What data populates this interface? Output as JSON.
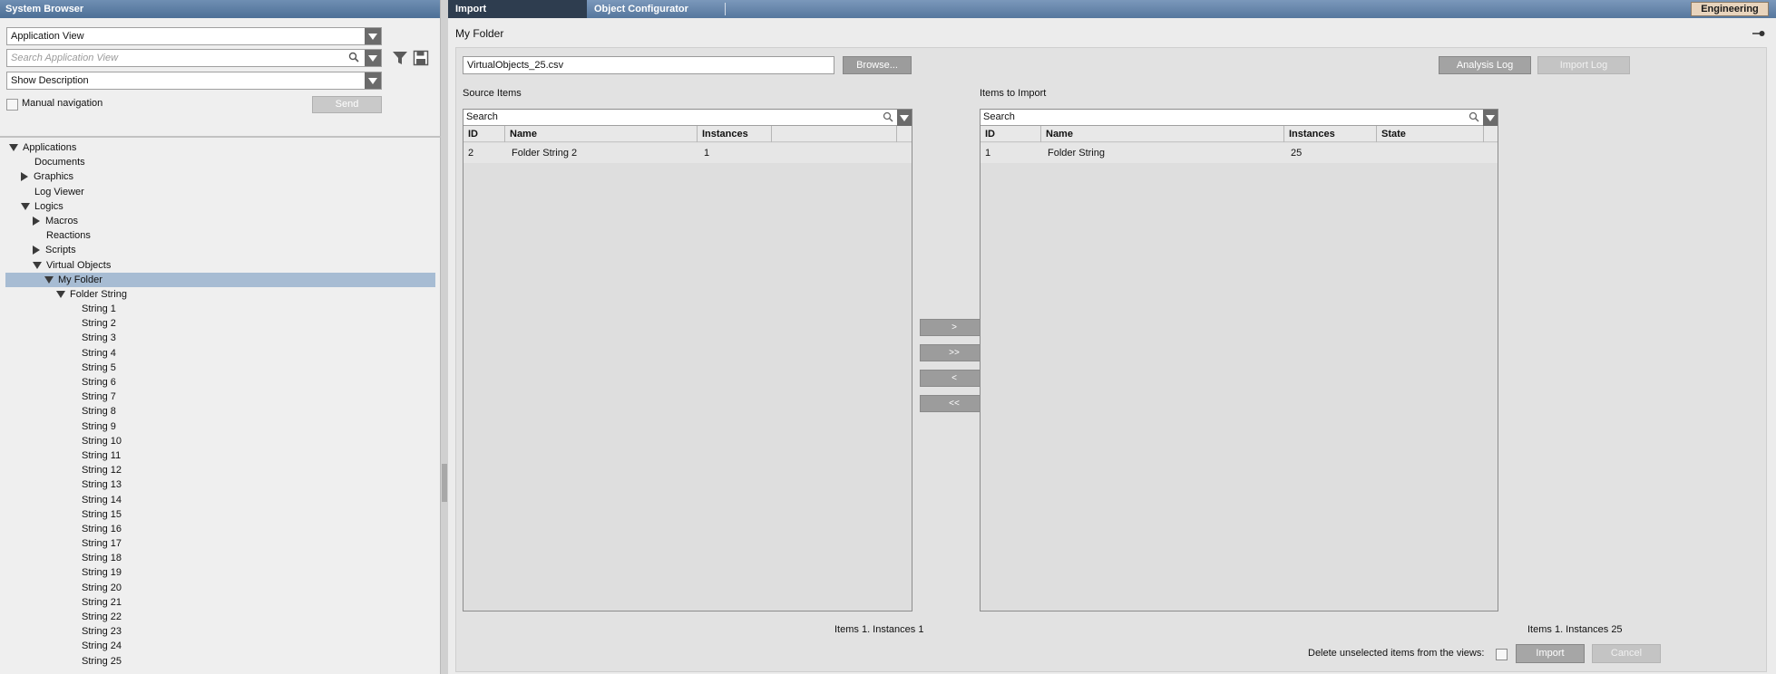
{
  "left_panel": {
    "title": "System Browser",
    "view_combo": "Application View",
    "search_placeholder": "Search Application View",
    "description_combo": "Show Description",
    "manual_navigation_label": "Manual navigation",
    "send_label": "Send",
    "tree": [
      {
        "label": "Applications",
        "level": 0,
        "toggle": "expanded"
      },
      {
        "label": "Documents",
        "level": 1,
        "toggle": "none"
      },
      {
        "label": "Graphics",
        "level": 1,
        "toggle": "collapsed"
      },
      {
        "label": "Log Viewer",
        "level": 1,
        "toggle": "none"
      },
      {
        "label": "Logics",
        "level": 1,
        "toggle": "expanded"
      },
      {
        "label": "Macros",
        "level": 2,
        "toggle": "collapsed"
      },
      {
        "label": "Reactions",
        "level": 2,
        "toggle": "none"
      },
      {
        "label": "Scripts",
        "level": 2,
        "toggle": "collapsed"
      },
      {
        "label": "Virtual Objects",
        "level": 2,
        "toggle": "expanded"
      },
      {
        "label": "My Folder",
        "level": 3,
        "toggle": "expanded",
        "selected": true
      },
      {
        "label": "Folder String",
        "level": 4,
        "toggle": "expanded"
      },
      {
        "label": "String 1",
        "level": 5,
        "toggle": "none"
      },
      {
        "label": "String 2",
        "level": 5,
        "toggle": "none"
      },
      {
        "label": "String 3",
        "level": 5,
        "toggle": "none"
      },
      {
        "label": "String 4",
        "level": 5,
        "toggle": "none"
      },
      {
        "label": "String 5",
        "level": 5,
        "toggle": "none"
      },
      {
        "label": "String 6",
        "level": 5,
        "toggle": "none"
      },
      {
        "label": "String 7",
        "level": 5,
        "toggle": "none"
      },
      {
        "label": "String 8",
        "level": 5,
        "toggle": "none"
      },
      {
        "label": "String 9",
        "level": 5,
        "toggle": "none"
      },
      {
        "label": "String 10",
        "level": 5,
        "toggle": "none"
      },
      {
        "label": "String 11",
        "level": 5,
        "toggle": "none"
      },
      {
        "label": "String 12",
        "level": 5,
        "toggle": "none"
      },
      {
        "label": "String 13",
        "level": 5,
        "toggle": "none"
      },
      {
        "label": "String 14",
        "level": 5,
        "toggle": "none"
      },
      {
        "label": "String 15",
        "level": 5,
        "toggle": "none"
      },
      {
        "label": "String 16",
        "level": 5,
        "toggle": "none"
      },
      {
        "label": "String 17",
        "level": 5,
        "toggle": "none"
      },
      {
        "label": "String 18",
        "level": 5,
        "toggle": "none"
      },
      {
        "label": "String 19",
        "level": 5,
        "toggle": "none"
      },
      {
        "label": "String 20",
        "level": 5,
        "toggle": "none"
      },
      {
        "label": "String 21",
        "level": 5,
        "toggle": "none"
      },
      {
        "label": "String 22",
        "level": 5,
        "toggle": "none"
      },
      {
        "label": "String 23",
        "level": 5,
        "toggle": "none"
      },
      {
        "label": "String 24",
        "level": 5,
        "toggle": "none"
      },
      {
        "label": "String 25",
        "level": 5,
        "toggle": "none"
      }
    ]
  },
  "tabs": [
    {
      "label": "Import",
      "active": true
    },
    {
      "label": "Object Configurator",
      "active": false
    }
  ],
  "mode_badge": "Engineering",
  "page_title": "My Folder",
  "file": {
    "name": "VirtualObjects_25.csv",
    "browse_label": "Browse..."
  },
  "logs": {
    "analysis_label": "Analysis Log",
    "import_label": "Import Log"
  },
  "source": {
    "label": "Source Items",
    "search_placeholder": "Search",
    "columns": [
      "ID",
      "Name",
      "Instances"
    ],
    "rows": [
      {
        "id": "2",
        "name": "Folder String 2",
        "instances": "1"
      }
    ],
    "status": "Items 1. Instances 1"
  },
  "transfer_buttons": [
    ">",
    ">>",
    "<",
    "<<"
  ],
  "target": {
    "label": "Items to Import",
    "search_placeholder": "Search",
    "columns": [
      "ID",
      "Name",
      "Instances",
      "State"
    ],
    "rows": [
      {
        "id": "1",
        "name": "Folder String",
        "instances": "25",
        "state": ""
      }
    ],
    "status": "Items 1. Instances 25"
  },
  "footer": {
    "delete_label": "Delete unselected items from the views:",
    "import_label": "Import",
    "cancel_label": "Cancel"
  },
  "colors": {
    "header_blue": "#56779d",
    "active_tab": "#2e3d4f",
    "selection": "#a7bcd3",
    "badge": "#e8d4bd"
  }
}
